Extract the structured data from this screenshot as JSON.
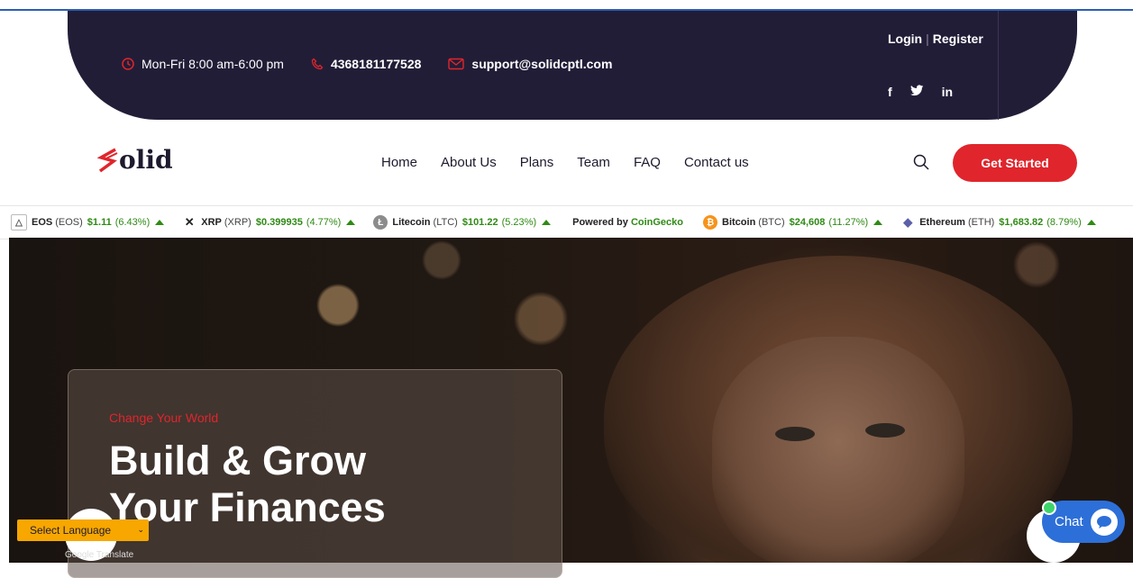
{
  "topbar": {
    "hours": "Mon-Fri 8:00 am-6:00 pm",
    "phone": "4368181177528",
    "email": "support@solidcptl.com",
    "login": "Login",
    "separator": "|",
    "register": "Register",
    "social": [
      "f",
      "in"
    ]
  },
  "nav": {
    "logo": "olid",
    "items": [
      "Home",
      "About Us",
      "Plans",
      "Team",
      "FAQ",
      "Contact us"
    ],
    "cta": "Get Started"
  },
  "ticker": {
    "items": [
      {
        "name": "EOS",
        "sym": "(EOS)",
        "price": "$1.11",
        "chg": "(6.43%)"
      },
      {
        "name": "XRP",
        "sym": "(XRP)",
        "price": "$0.399935",
        "chg": "(4.77%)"
      },
      {
        "name": "Litecoin",
        "sym": "(LTC)",
        "price": "$101.22",
        "chg": "(5.23%)"
      },
      {
        "name": "Bitcoin",
        "sym": "(BTC)",
        "price": "$24,608",
        "chg": "(11.27%)"
      },
      {
        "name": "Ethereum",
        "sym": "(ETH)",
        "price": "$1,683.82",
        "chg": "(8.79%)"
      }
    ],
    "powered_prefix": "Powered by",
    "powered_brand": "CoinGecko"
  },
  "hero": {
    "eyebrow": "Change Your World",
    "title_line1": "Build & Grow",
    "title_line2": "Your Finances"
  },
  "widgets": {
    "language": "Select Language",
    "translate": "Google Translate",
    "chat": "Chat"
  },
  "colors": {
    "accent": "#e0252c",
    "dark": "#221d37",
    "ticker_green": "#2f8a15",
    "chat_blue": "#2d6fd8"
  }
}
